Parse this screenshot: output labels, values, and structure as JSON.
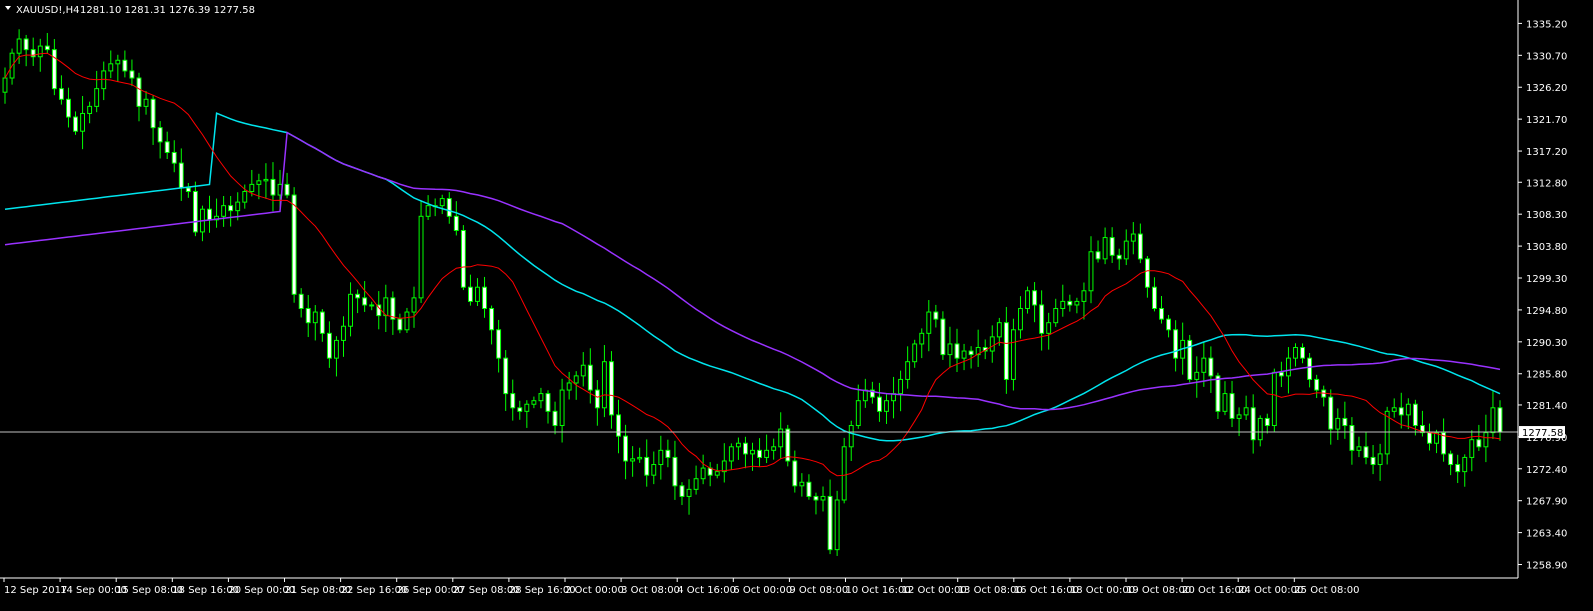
{
  "header": {
    "symbol": "XAUUSD!,H4",
    "ohlc": "1281.10 1281.31 1276.39 1277.58"
  },
  "colors": {
    "background": "#000000",
    "axis": "#ffffff",
    "bull_body": "#000000",
    "bull_border": "#00ff00",
    "bear_body": "#ffffff",
    "bear_border": "#00ff00",
    "wick": "#00ff00",
    "ma_fast": "#ff0000",
    "ma_slow_1": "#00e5ee",
    "ma_slow_2": "#9932ff",
    "price_line": "#c0c0c0"
  },
  "chart_data": {
    "type": "candlestick",
    "ylim": [
      1257.0,
      1338.5
    ],
    "y_ticks": [
      "1335.20",
      "1330.70",
      "1326.20",
      "1321.70",
      "1317.20",
      "1312.80",
      "1308.30",
      "1303.80",
      "1299.30",
      "1294.80",
      "1290.30",
      "1285.80",
      "1281.40",
      "1276.90",
      "1272.40",
      "1267.90",
      "1263.40",
      "1258.90"
    ],
    "x_ticks": [
      "12 Sep 2017",
      "14 Sep 00:00",
      "15 Sep 08:00",
      "18 Sep 16:00",
      "20 Sep 00:00",
      "21 Sep 08:00",
      "22 Sep 16:00",
      "26 Sep 00:00",
      "27 Sep 08:00",
      "28 Sep 16:00",
      "2 Oct 00:00",
      "3 Oct 08:00",
      "4 Oct 16:00",
      "6 Oct 00:00",
      "9 Oct 08:00",
      "10 Oct 16:00",
      "12 Oct 00:00",
      "13 Oct 08:00",
      "16 Oct 16:00",
      "18 Oct 00:00",
      "19 Oct 08:00",
      "20 Oct 16:00",
      "24 Oct 00:00",
      "25 Oct 08:00"
    ],
    "current_price": "1277.58",
    "close": [
      1327.5,
      1331.0,
      1333.0,
      1331.5,
      1330.5,
      1332.0,
      1331.5,
      1326.0,
      1324.5,
      1322.0,
      1320.0,
      1322.5,
      1323.5,
      1326.0,
      1328.5,
      1329.5,
      1330.0,
      1328.5,
      1327.5,
      1323.5,
      1324.5,
      1320.5,
      1318.5,
      1317.0,
      1315.5,
      1312.0,
      1311.5,
      1305.8,
      1309.0,
      1307.5,
      1308.0,
      1309.5,
      1308.8,
      1310.0,
      1311.5,
      1312.5,
      1313.0,
      1313.2,
      1311.0,
      1312.5,
      1311.0,
      1297.0,
      1295.0,
      1293.0,
      1294.5,
      1291.5,
      1288.0,
      1290.5,
      1292.5,
      1297.0,
      1296.5,
      1295.5,
      1295.5,
      1294.0,
      1296.5,
      1293.5,
      1292.0,
      1294.5,
      1296.5,
      1308.0,
      1309.5,
      1309.5,
      1310.5,
      1308.0,
      1306.0,
      1298.0,
      1296.0,
      1298.0,
      1295.0,
      1292.0,
      1288.0,
      1283.0,
      1281.0,
      1280.5,
      1281.5,
      1282.0,
      1283.0,
      1280.5,
      1278.5,
      1283.5,
      1284.5,
      1285.5,
      1287.0,
      1283.5,
      1281.0,
      1287.5,
      1280.0,
      1277.0,
      1273.5,
      1273.8,
      1274.0,
      1271.5,
      1273.0,
      1275.0,
      1274.0,
      1270.0,
      1268.5,
      1269.5,
      1271.0,
      1272.5,
      1271.5,
      1272.0,
      1273.5,
      1275.5,
      1276.0,
      1274.5,
      1275.0,
      1274.0,
      1275.0,
      1275.5,
      1278.0,
      1273.5,
      1270.0,
      1270.5,
      1268.5,
      1268.0,
      1268.5,
      1261.0,
      1268.0,
      1275.5,
      1278.5,
      1282.0,
      1283.5,
      1282.5,
      1280.5,
      1282.0,
      1283.0,
      1285.0,
      1287.5,
      1290.0,
      1291.5,
      1294.5,
      1293.5,
      1288.5,
      1290.0,
      1288.0,
      1289.0,
      1288.5,
      1289.5,
      1289.0,
      1291.0,
      1293.0,
      1285.0,
      1292.0,
      1295.0,
      1297.5,
      1295.5,
      1291.5,
      1293.0,
      1295.0,
      1296.0,
      1295.5,
      1296.0,
      1297.5,
      1303.0,
      1302.0,
      1305.0,
      1302.5,
      1302.0,
      1304.5,
      1305.5,
      1302.0,
      1298.0,
      1295.0,
      1293.5,
      1292.0,
      1288.0,
      1290.5,
      1285.0,
      1286.0,
      1288.0,
      1285.5,
      1280.5,
      1283.0,
      1279.5,
      1280.0,
      1281.0,
      1276.5,
      1279.5,
      1278.5,
      1286.0,
      1285.5,
      1288.0,
      1289.5,
      1288.0,
      1285.0,
      1283.5,
      1282.5,
      1278.0,
      1279.5,
      1278.5,
      1275.0,
      1275.5,
      1274.0,
      1273.0,
      1274.5,
      1280.5,
      1281.0,
      1280.0,
      1281.5,
      1278.5,
      1277.5,
      1276.0,
      1277.5,
      1274.5,
      1273.0,
      1272.0,
      1274.0,
      1276.5,
      1275.5,
      1277.5,
      1281.0,
      1277.58
    ]
  }
}
